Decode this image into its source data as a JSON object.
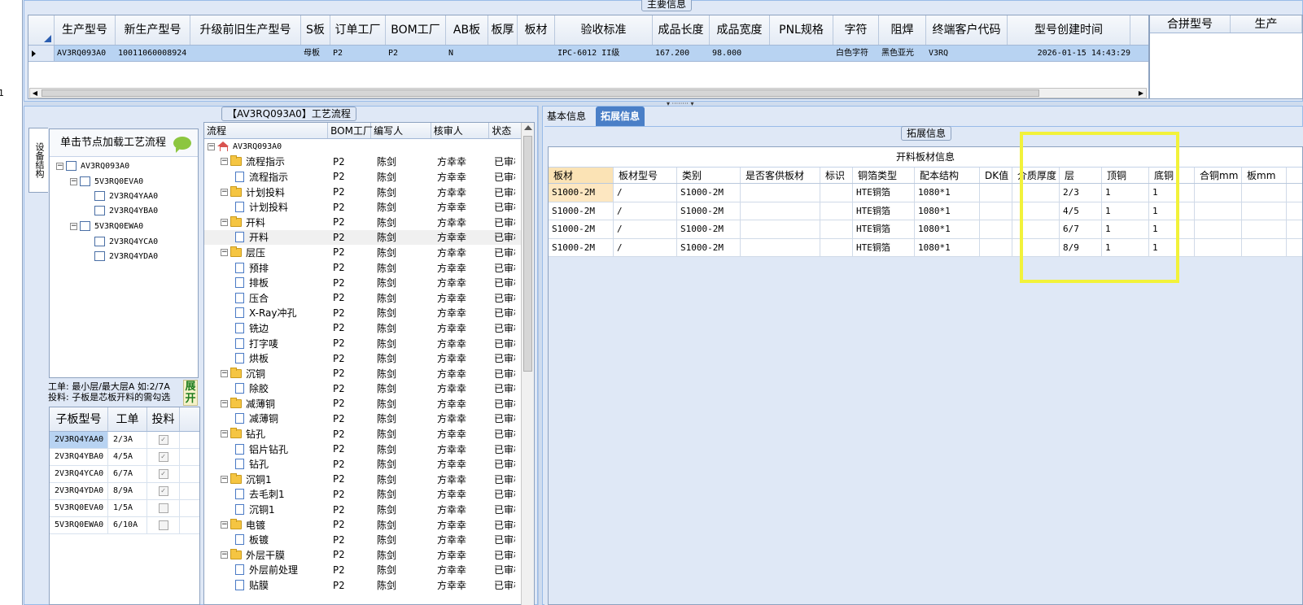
{
  "main_info": {
    "title": "主要信息",
    "columns": [
      "生产型号",
      "新生产型号",
      "升级前旧生产型号",
      "S板",
      "订单工厂",
      "BOM工厂",
      "AB板",
      "板厚",
      "板材",
      "验收标准",
      "成品长度",
      "成品宽度",
      "PNL规格",
      "字符",
      "阻焊",
      "终端客户代码",
      "型号创建时间"
    ],
    "row": [
      "AV3RQ093A0",
      "10011060008924",
      "",
      "母板",
      "P2",
      "P2",
      "N",
      "",
      "",
      "IPC-6012 II级",
      "167.200",
      "98.000",
      "",
      "白色字符",
      "黑色亚光",
      "V3RQ",
      "2026-01-15 14:43:29"
    ],
    "merge_columns": [
      "合拼型号",
      "生产"
    ]
  },
  "left_panel": {
    "vtab_label": "设备结构",
    "tree_header": "单击节点加载工艺流程",
    "tree": [
      {
        "label": "AV3RQ093A0",
        "level": 0
      },
      {
        "label": "5V3RQ0EVA0",
        "level": 1
      },
      {
        "label": "2V3RQ4YAA0",
        "level": 2
      },
      {
        "label": "2V3RQ4YBA0",
        "level": 2
      },
      {
        "label": "5V3RQ0EWA0",
        "level": 1
      },
      {
        "label": "2V3RQ4YCA0",
        "level": 2
      },
      {
        "label": "2V3RQ4YDA0",
        "level": 2
      }
    ],
    "note_line1": "工单: 最小层/最大层A 如:2/7A",
    "note_line2": "投料: 子板是芯板开料的需勾选",
    "expand_label": "展开",
    "sub_columns": [
      "子板型号",
      "工单",
      "投料"
    ],
    "sub_rows": [
      {
        "model": "2V3RQ4YAA0",
        "order": "2/3A",
        "feed": true
      },
      {
        "model": "2V3RQ4YBA0",
        "order": "4/5A",
        "feed": true
      },
      {
        "model": "2V3RQ4YCA0",
        "order": "6/7A",
        "feed": true
      },
      {
        "model": "2V3RQ4YDA0",
        "order": "8/9A",
        "feed": true
      },
      {
        "model": "5V3RQ0EVA0",
        "order": "1/5A",
        "feed": false
      },
      {
        "model": "5V3RQ0EWA0",
        "order": "6/10A",
        "feed": false
      }
    ]
  },
  "process": {
    "title": "【AV3RQ093A0】工艺流程",
    "columns": [
      "流程",
      "BOM工厂",
      "编写人",
      "核审人",
      "状态"
    ],
    "rows": [
      {
        "name": "AV3RQ093A0",
        "type": "root",
        "bom": "",
        "writer": "",
        "checker": "",
        "status": ""
      },
      {
        "name": "流程指示",
        "type": "folder",
        "bom": "P2",
        "writer": "陈剑",
        "checker": "方幸幸",
        "status": "已审核"
      },
      {
        "name": "流程指示",
        "type": "doc",
        "bom": "P2",
        "writer": "陈剑",
        "checker": "方幸幸",
        "status": "已审核"
      },
      {
        "name": "计划投料",
        "type": "folder",
        "bom": "P2",
        "writer": "陈剑",
        "checker": "方幸幸",
        "status": "已审核"
      },
      {
        "name": "计划投料",
        "type": "doc",
        "bom": "P2",
        "writer": "陈剑",
        "checker": "方幸幸",
        "status": "已审核"
      },
      {
        "name": "开料",
        "type": "folder",
        "bom": "P2",
        "writer": "陈剑",
        "checker": "方幸幸",
        "status": "已审核"
      },
      {
        "name": "开料",
        "type": "doc",
        "bom": "P2",
        "writer": "陈剑",
        "checker": "方幸幸",
        "status": "已审核",
        "selected": true
      },
      {
        "name": "层压",
        "type": "folder",
        "bom": "P2",
        "writer": "陈剑",
        "checker": "方幸幸",
        "status": "已审核"
      },
      {
        "name": "预排",
        "type": "doc",
        "bom": "P2",
        "writer": "陈剑",
        "checker": "方幸幸",
        "status": "已审核"
      },
      {
        "name": "排板",
        "type": "doc",
        "bom": "P2",
        "writer": "陈剑",
        "checker": "方幸幸",
        "status": "已审核"
      },
      {
        "name": "压合",
        "type": "doc",
        "bom": "P2",
        "writer": "陈剑",
        "checker": "方幸幸",
        "status": "已审核"
      },
      {
        "name": "X-Ray冲孔",
        "type": "doc",
        "bom": "P2",
        "writer": "陈剑",
        "checker": "方幸幸",
        "status": "已审核"
      },
      {
        "name": "铣边",
        "type": "doc",
        "bom": "P2",
        "writer": "陈剑",
        "checker": "方幸幸",
        "status": "已审核"
      },
      {
        "name": "打字唛",
        "type": "doc",
        "bom": "P2",
        "writer": "陈剑",
        "checker": "方幸幸",
        "status": "已审核"
      },
      {
        "name": "烘板",
        "type": "doc",
        "bom": "P2",
        "writer": "陈剑",
        "checker": "方幸幸",
        "status": "已审核"
      },
      {
        "name": "沉铜",
        "type": "folder",
        "bom": "P2",
        "writer": "陈剑",
        "checker": "方幸幸",
        "status": "已审核"
      },
      {
        "name": "除胶",
        "type": "doc",
        "bom": "P2",
        "writer": "陈剑",
        "checker": "方幸幸",
        "status": "已审核"
      },
      {
        "name": "减薄铜",
        "type": "folder",
        "bom": "P2",
        "writer": "陈剑",
        "checker": "方幸幸",
        "status": "已审核"
      },
      {
        "name": "减薄铜",
        "type": "doc",
        "bom": "P2",
        "writer": "陈剑",
        "checker": "方幸幸",
        "status": "已审核"
      },
      {
        "name": "钻孔",
        "type": "folder",
        "bom": "P2",
        "writer": "陈剑",
        "checker": "方幸幸",
        "status": "已审核"
      },
      {
        "name": "铝片钻孔",
        "type": "doc",
        "bom": "P2",
        "writer": "陈剑",
        "checker": "方幸幸",
        "status": "已审核"
      },
      {
        "name": "钻孔",
        "type": "doc",
        "bom": "P2",
        "writer": "陈剑",
        "checker": "方幸幸",
        "status": "已审核"
      },
      {
        "name": "沉铜1",
        "type": "folder",
        "bom": "P2",
        "writer": "陈剑",
        "checker": "方幸幸",
        "status": "已审核"
      },
      {
        "name": "去毛刺1",
        "type": "doc",
        "bom": "P2",
        "writer": "陈剑",
        "checker": "方幸幸",
        "status": "已审核"
      },
      {
        "name": "沉铜1",
        "type": "doc",
        "bom": "P2",
        "writer": "陈剑",
        "checker": "方幸幸",
        "status": "已审核"
      },
      {
        "name": "电镀",
        "type": "folder",
        "bom": "P2",
        "writer": "陈剑",
        "checker": "方幸幸",
        "status": "已审核"
      },
      {
        "name": "板镀",
        "type": "doc",
        "bom": "P2",
        "writer": "陈剑",
        "checker": "方幸幸",
        "status": "已审核"
      },
      {
        "name": "外层干膜",
        "type": "folder",
        "bom": "P2",
        "writer": "陈剑",
        "checker": "方幸幸",
        "status": "已审核"
      },
      {
        "name": "外层前处理",
        "type": "doc",
        "bom": "P2",
        "writer": "陈剑",
        "checker": "方幸幸",
        "status": "已审核"
      },
      {
        "name": "贴膜",
        "type": "doc",
        "bom": "P2",
        "writer": "陈剑",
        "checker": "方幸幸",
        "status": "已审核"
      }
    ]
  },
  "right_panel": {
    "tabs": [
      "基本信息",
      "拓展信息"
    ],
    "active_tab": "拓展信息",
    "section_title": "拓展信息",
    "table_caption": "开料板材信息",
    "columns": [
      "板材",
      "板材型号",
      "类别",
      "是否客供板材",
      "标识",
      "铜箔类型",
      "配本结构",
      "DK值",
      "介质厚度",
      "层",
      "顶铜",
      "底铜",
      "合铜mm",
      "板mm"
    ],
    "rows": [
      [
        "S1000-2M",
        "/",
        "S1000-2M",
        "",
        "",
        "HTE铜箔",
        "1080*1",
        "",
        "",
        "2/3",
        "1",
        "1",
        "",
        ""
      ],
      [
        "S1000-2M",
        "/",
        "S1000-2M",
        "",
        "",
        "HTE铜箔",
        "1080*1",
        "",
        "",
        "4/5",
        "1",
        "1",
        "",
        ""
      ],
      [
        "S1000-2M",
        "/",
        "S1000-2M",
        "",
        "",
        "HTE铜箔",
        "1080*1",
        "",
        "",
        "6/7",
        "1",
        "1",
        "",
        ""
      ],
      [
        "S1000-2M",
        "/",
        "S1000-2M",
        "",
        "",
        "HTE铜箔",
        "1080*1",
        "",
        "",
        "8/9",
        "1",
        "1",
        "",
        ""
      ]
    ]
  },
  "colors": {
    "panel_bg": "#dfe8f6",
    "selected_row": "#b8d3f2",
    "highlight_box": "#f2f23a",
    "active_tab": "#4a7fc7"
  }
}
